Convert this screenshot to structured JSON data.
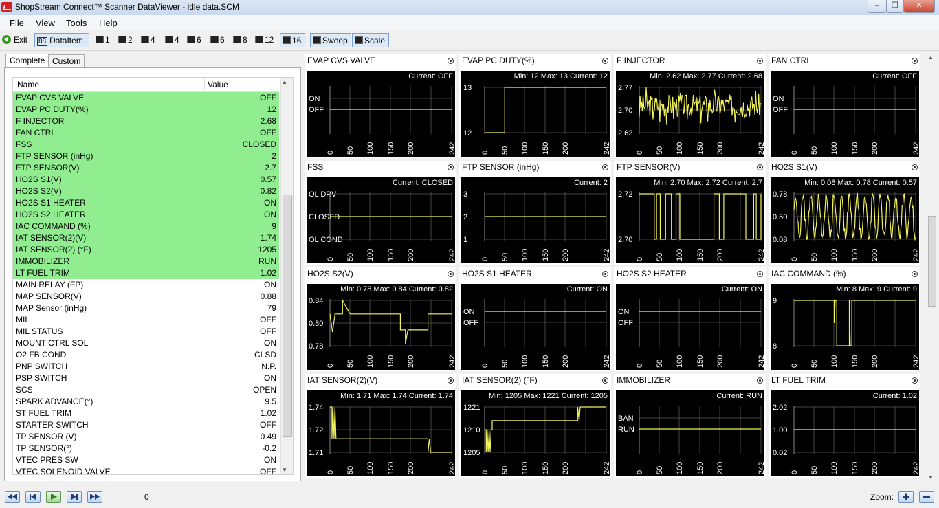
{
  "window": {
    "title": "ShopStream Connect™ Scanner DataViewer - idle data.SCM",
    "minimize": "–",
    "maximize": "❐",
    "close": "✕"
  },
  "menu": [
    "File",
    "View",
    "Tools",
    "Help"
  ],
  "toolbar": {
    "exit": "Exit",
    "dataitem": "DataItem",
    "layouts": [
      "1",
      "2",
      "4",
      "4",
      "6",
      "6",
      "8",
      "12",
      "16"
    ],
    "sweep": "Sweep",
    "scale": "Scale",
    "selected_layout": "16"
  },
  "tabs": [
    "Complete",
    "Custom"
  ],
  "list": {
    "col_name": "Name",
    "col_value": "Value",
    "rows": [
      {
        "name": "EVAP CVS VALVE",
        "value": "OFF",
        "selected": true
      },
      {
        "name": "EVAP PC DUTY(%)",
        "value": "12",
        "selected": true
      },
      {
        "name": "F INJECTOR",
        "value": "2.68",
        "selected": true
      },
      {
        "name": "FAN CTRL",
        "value": "OFF",
        "selected": true
      },
      {
        "name": "FSS",
        "value": "CLOSED",
        "selected": true
      },
      {
        "name": "FTP SENSOR (inHg)",
        "value": "2",
        "selected": true
      },
      {
        "name": "FTP SENSOR(V)",
        "value": "2.7",
        "selected": true
      },
      {
        "name": "HO2S S1(V)",
        "value": "0.57",
        "selected": true
      },
      {
        "name": "HO2S S2(V)",
        "value": "0.82",
        "selected": true
      },
      {
        "name": "HO2S S1 HEATER",
        "value": "ON",
        "selected": true
      },
      {
        "name": "HO2S S2 HEATER",
        "value": "ON",
        "selected": true
      },
      {
        "name": "IAC COMMAND (%)",
        "value": "9",
        "selected": true
      },
      {
        "name": "IAT SENSOR(2)(V)",
        "value": "1.74",
        "selected": true
      },
      {
        "name": "IAT SENSOR(2) (°F)",
        "value": "1205",
        "selected": true
      },
      {
        "name": "IMMOBILIZER",
        "value": "RUN",
        "selected": true
      },
      {
        "name": "LT FUEL TRIM",
        "value": "1.02",
        "selected": true
      },
      {
        "name": "MAIN RELAY (FP)",
        "value": "ON",
        "selected": false
      },
      {
        "name": "MAP SENSOR(V)",
        "value": "0.88",
        "selected": false
      },
      {
        "name": "MAP Sensor (inHg)",
        "value": "79",
        "selected": false
      },
      {
        "name": "MIL",
        "value": "OFF",
        "selected": false
      },
      {
        "name": "MIL STATUS",
        "value": "OFF",
        "selected": false
      },
      {
        "name": "MOUNT CTRL SOL",
        "value": "ON",
        "selected": false
      },
      {
        "name": "O2 FB COND",
        "value": "CLSD",
        "selected": false
      },
      {
        "name": "PNP SWITCH",
        "value": "N.P.",
        "selected": false
      },
      {
        "name": "PSP SWITCH",
        "value": "ON",
        "selected": false
      },
      {
        "name": "SCS",
        "value": "OPEN",
        "selected": false
      },
      {
        "name": "SPARK ADVANCE(°)",
        "value": "9.5",
        "selected": false
      },
      {
        "name": "ST FUEL TRIM",
        "value": "1.02",
        "selected": false
      },
      {
        "name": "STARTER SWITCH",
        "value": "OFF",
        "selected": false
      },
      {
        "name": "TP SENSOR (V)",
        "value": "0.49",
        "selected": false
      },
      {
        "name": "TP SENSOR(°)",
        "value": "-0.2",
        "selected": false
      },
      {
        "name": "VTEC PRES SW",
        "value": "ON",
        "selected": false
      },
      {
        "name": "VTEC SOLENOID VALVE",
        "value": "OFF",
        "selected": false
      }
    ]
  },
  "charts": [
    {
      "title": "EVAP CVS VALVE",
      "kind": "disc",
      "info": "Current: OFF",
      "labels": [
        "ON",
        "OFF"
      ],
      "series": {
        "type": "flat",
        "level": 1
      }
    },
    {
      "title": "EVAP PC DUTY(%)",
      "kind": "num",
      "info": "Min: 12     Max: 13     Current: 12",
      "labels": [
        "13",
        "12"
      ],
      "series": {
        "type": "steps",
        "pts": [
          [
            0,
            0
          ],
          [
            40,
            0
          ],
          [
            40,
            1
          ],
          [
            242,
            1
          ]
        ]
      }
    },
    {
      "title": "F INJECTOR",
      "kind": "num",
      "info": "Min: 2.62     Max: 2.77     Current: 2.68",
      "labels": [
        "2.77",
        "2.70",
        "2.62"
      ],
      "series": {
        "type": "noise",
        "center": 0.6,
        "amp": 0.25,
        "seed": 3
      }
    },
    {
      "title": "FAN CTRL",
      "kind": "disc",
      "info": "Current: OFF",
      "labels": [
        "ON",
        "OFF"
      ],
      "series": {
        "type": "flat",
        "level": 1
      }
    },
    {
      "title": "FSS",
      "kind": "disc",
      "info": "Current: CLOSED",
      "labels": [
        "OL DRV",
        "CLOSED",
        "OL COND"
      ],
      "series": {
        "type": "flat",
        "level": 1
      }
    },
    {
      "title": "FTP SENSOR (inHg)",
      "kind": "num",
      "info": "Current: 2",
      "labels": [
        "3",
        "2",
        "1"
      ],
      "series": {
        "type": "flat",
        "level": 1
      }
    },
    {
      "title": "FTP SENSOR(V)",
      "kind": "num",
      "info": "Min: 2.70     Max: 2.72     Current: 2.7",
      "labels": [
        "2.72",
        "2.70"
      ],
      "series": {
        "type": "spikes",
        "seed": 5
      }
    },
    {
      "title": "HO2S S1(V)",
      "kind": "num",
      "info": "Min: 0.08     Max: 0.78     Current: 0.57",
      "labels": [
        "0.78",
        "0.50",
        "0.08"
      ],
      "series": {
        "type": "osc",
        "seed": 7
      }
    },
    {
      "title": "HO2S S2(V)",
      "kind": "num",
      "info": "Min: 0.78     Max: 0.84     Current: 0.82",
      "labels": [
        "0.84",
        "0.80",
        "0.78"
      ],
      "series": {
        "type": "steps",
        "pts": [
          [
            0,
            0.7
          ],
          [
            5,
            0.3
          ],
          [
            10,
            0.7
          ],
          [
            25,
            0.7
          ],
          [
            25,
            1
          ],
          [
            40,
            0.7
          ],
          [
            140,
            0.7
          ],
          [
            140,
            0.35
          ],
          [
            150,
            0.35
          ],
          [
            150,
            0.05
          ],
          [
            155,
            0.35
          ],
          [
            195,
            0.35
          ],
          [
            195,
            0.7
          ],
          [
            242,
            0.7
          ]
        ]
      }
    },
    {
      "title": "HO2S S1 HEATER",
      "kind": "disc",
      "info": "Current: ON",
      "labels": [
        "ON",
        "OFF"
      ],
      "series": {
        "type": "flat",
        "level": 0.5
      }
    },
    {
      "title": "HO2S S2 HEATER",
      "kind": "disc",
      "info": "Current: ON",
      "labels": [
        "ON",
        "OFF"
      ],
      "series": {
        "type": "flat",
        "level": 0.5
      }
    },
    {
      "title": "IAC COMMAND (%)",
      "kind": "num",
      "info": "Min: 8     Max: 9     Current: 9",
      "labels": [
        "9",
        "8"
      ],
      "series": {
        "type": "steps",
        "pts": [
          [
            0,
            1
          ],
          [
            80,
            1
          ],
          [
            80,
            0.5
          ],
          [
            82,
            1
          ],
          [
            85,
            1
          ],
          [
            85,
            0
          ],
          [
            110,
            0
          ],
          [
            110,
            1
          ],
          [
            112,
            0
          ],
          [
            115,
            0
          ],
          [
            115,
            1
          ],
          [
            242,
            1
          ]
        ]
      }
    },
    {
      "title": "IAT SENSOR(2)(V)",
      "kind": "num",
      "info": "Min: 1.71     Max: 1.74     Current: 1.74",
      "labels": [
        "1.74",
        "1.72",
        "1.71"
      ],
      "series": {
        "type": "steps",
        "pts": [
          [
            0,
            1
          ],
          [
            4,
            1
          ],
          [
            4,
            0.3
          ],
          [
            6,
            1
          ],
          [
            8,
            0.3
          ],
          [
            10,
            1
          ],
          [
            12,
            0.3
          ],
          [
            12,
            0.3
          ],
          [
            195,
            0.3
          ],
          [
            195,
            0
          ],
          [
            198,
            0.3
          ],
          [
            200,
            0
          ],
          [
            242,
            0
          ]
        ]
      }
    },
    {
      "title": "IAT SENSOR(2) (°F)",
      "kind": "num",
      "info": "Min: 1205     Max: 1221     Current: 1205",
      "labels": [
        "1221",
        "1210",
        "1205"
      ],
      "series": {
        "type": "steps",
        "pts": [
          [
            0,
            0.5
          ],
          [
            3,
            0.5
          ],
          [
            3,
            0
          ],
          [
            5,
            0.5
          ],
          [
            7,
            0
          ],
          [
            9,
            0.5
          ],
          [
            11,
            0
          ],
          [
            13,
            0.5
          ],
          [
            15,
            0.5
          ],
          [
            15,
            0.7
          ],
          [
            185,
            0.7
          ],
          [
            185,
            1
          ],
          [
            188,
            0.7
          ],
          [
            190,
            1
          ],
          [
            242,
            1
          ]
        ]
      }
    },
    {
      "title": "IMMOBILIZER",
      "kind": "disc",
      "info": "Current: RUN",
      "labels": [
        "BAN",
        "RUN"
      ],
      "series": {
        "type": "flat",
        "level": 0.5
      }
    },
    {
      "title": "LT FUEL TRIM",
      "kind": "num",
      "info": "Current: 1.02",
      "labels": [
        "2.02",
        "1.00",
        "0.02"
      ],
      "series": {
        "type": "flat",
        "level": 0.5
      }
    }
  ],
  "xticks": [
    "0",
    "50",
    "100",
    "150",
    "200",
    "242"
  ],
  "status": {
    "position": "0",
    "zoom_label": "Zoom:"
  }
}
